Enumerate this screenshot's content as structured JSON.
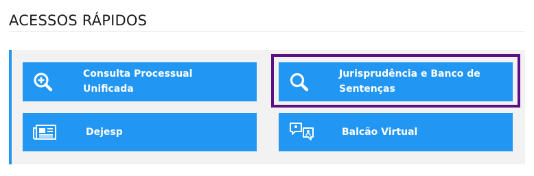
{
  "section": {
    "title": "ACESSOS RÁPIDOS"
  },
  "tiles": [
    {
      "label_line1": "Consulta Processual",
      "label_line2": "Unificada",
      "icon": "zoom-in-icon"
    },
    {
      "label_line1": "Jurisprudência e Banco de",
      "label_line2": "Sentenças",
      "icon": "search-icon"
    },
    {
      "label": "Dejesp",
      "icon": "newspaper-icon"
    },
    {
      "label": "Balcão Virtual",
      "icon": "chat-bubbles-icon"
    }
  ],
  "colors": {
    "tile_background": "#2196f3",
    "panel_background": "#f2f2f2",
    "panel_accent": "#2196f3",
    "highlight_border": "#5c0f84"
  }
}
